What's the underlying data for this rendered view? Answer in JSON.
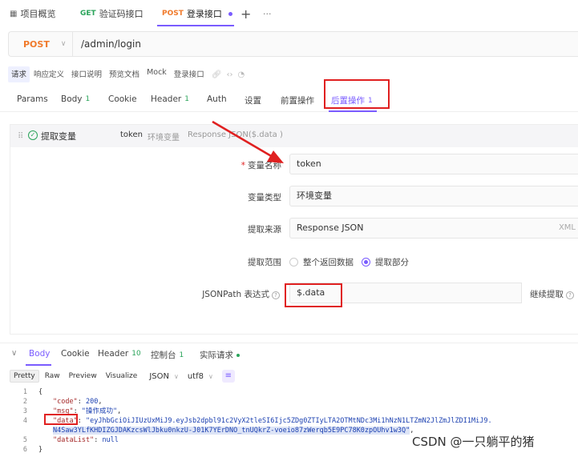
{
  "tabs": [
    {
      "icon": "grid-icon",
      "label": "项目概览"
    },
    {
      "method": "GET",
      "label": "验证码接口"
    },
    {
      "method": "POST",
      "label": "登录接口"
    }
  ],
  "tabbar_extras": {
    "add": "+",
    "more": "···"
  },
  "request": {
    "method": "POST",
    "url": "/admin/login"
  },
  "subtabs": [
    "请求",
    "响应定义",
    "接口说明",
    "预览文档",
    "Mock",
    "登录接口"
  ],
  "param_tabs": [
    {
      "label": "Params",
      "count": ""
    },
    {
      "label": "Body",
      "count": "1"
    },
    {
      "label": "Cookie",
      "count": ""
    },
    {
      "label": "Header",
      "count": "1"
    },
    {
      "label": "Auth",
      "count": ""
    },
    {
      "label": "设置",
      "count": ""
    },
    {
      "label": "前置操作",
      "count": ""
    },
    {
      "label": "后置操作",
      "count": "1"
    }
  ],
  "extract": {
    "title": "提取变量",
    "summary_var": "token",
    "summary_type": "环境变量",
    "summary_source": "Response JSON($.data )",
    "fields": {
      "name_label": "变量名称",
      "name_value": "token",
      "type_label": "变量类型",
      "type_value": "环境变量",
      "source_label": "提取来源",
      "source_value": "Response JSON",
      "source_suffix": "XML",
      "scope_label": "提取范围",
      "scope_all": "整个返回数据",
      "scope_part": "提取部分",
      "jsonpath_label": "JSONPath 表达式",
      "jsonpath_value": "$.data",
      "continue_label": "继续提取"
    }
  },
  "response_tabs": [
    {
      "label": "Body",
      "count": ""
    },
    {
      "label": "Cookie",
      "count": ""
    },
    {
      "label": "Header",
      "count": "10"
    },
    {
      "label": "控制台",
      "count": "1"
    },
    {
      "label": "实际请求",
      "count": ""
    }
  ],
  "format_bar": {
    "modes": [
      "Pretty",
      "Raw",
      "Preview",
      "Visualize"
    ],
    "type": "JSON",
    "encoding": "utf8"
  },
  "code_lines": [
    {
      "num": "1",
      "text": "{"
    },
    {
      "num": "2",
      "key": "\"code\"",
      "sep": ": ",
      "val": "200",
      "tail": ","
    },
    {
      "num": "3",
      "key": "\"msg\"",
      "sep": ": ",
      "val": "\"操作成功\"",
      "tail": ","
    },
    {
      "num": "4",
      "key": "\"data\"",
      "sep": ": ",
      "val": "\"eyJhbGciOiJIUzUxMiJ9.eyJsb2dpbl91c2VyX2tleSI6Ijc5ZDg0ZTIyLTA2OTMtNDc3Mi1hNzN1LTZmN2JlZmJlZDI1MiJ9.",
      "tail": ""
    },
    {
      "num": "",
      "val": "N4Saw3YLfKHDIZGJDAKzcsWlJbku0nkzU-J01K7YErDNO_tnUQkrZ-voeio87zWerqb5E9PC78K0zpOUhv1w3Q\"",
      "tail": ","
    },
    {
      "num": "5",
      "key": "\"dataList\"",
      "sep": ": ",
      "val": "null",
      "tail": ""
    },
    {
      "num": "6",
      "text": "}"
    }
  ],
  "watermark": "CSDN @一只躺平的猪",
  "colors": {
    "accent": "#7a5cff",
    "post": "#f07a2b",
    "get": "#2aa45a",
    "annotation": "#e02020"
  }
}
